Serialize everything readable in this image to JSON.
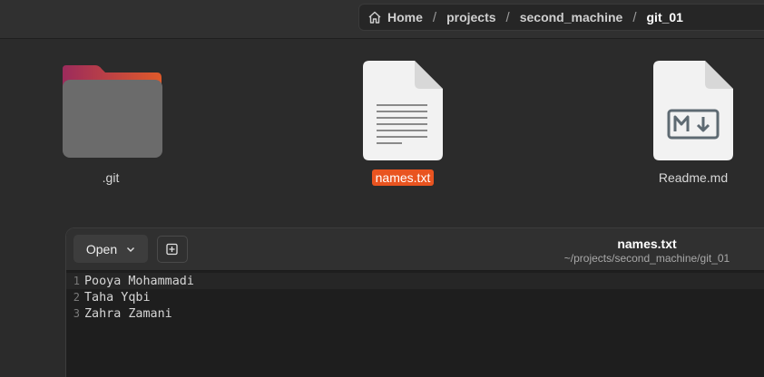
{
  "breadcrumb": {
    "items": [
      "Home",
      "projects",
      "second_machine",
      "git_01"
    ],
    "separator": "/"
  },
  "files": [
    {
      "name": ".git",
      "type": "folder"
    },
    {
      "name": "names.txt",
      "type": "text",
      "selected": true
    },
    {
      "name": "Readme.md",
      "type": "markdown"
    }
  ],
  "editor": {
    "open_label": "Open",
    "title": "names.txt",
    "path": "~/projects/second_machine/git_01",
    "lines": [
      {
        "number": "1",
        "text": "Pooya Mohammadi"
      },
      {
        "number": "2",
        "text": "Taha Yqbi"
      },
      {
        "number": "3",
        "text": "Zahra Zamani"
      }
    ]
  },
  "colors": {
    "accent": "#e95420",
    "background": "#2b2b2b"
  }
}
